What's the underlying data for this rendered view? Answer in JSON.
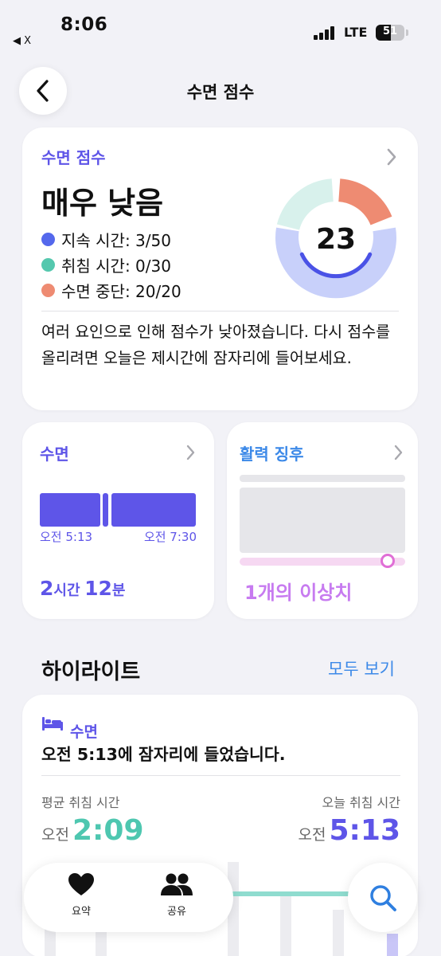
{
  "status_bar": {
    "time": "8:06",
    "back_app": "◀ X",
    "network": "LTE",
    "battery": "51"
  },
  "nav": {
    "title": "수면 점수"
  },
  "score_card": {
    "label": "수면 점수",
    "level": "매우 낮음",
    "score": "23",
    "factors": [
      {
        "label": "지속 시간: 3/50",
        "color": "#5468ec",
        "value": 3,
        "max": 50
      },
      {
        "label": "취침 시간: 0/30",
        "color": "#55c8ae",
        "value": 0,
        "max": 30
      },
      {
        "label": "수면 중단: 20/20",
        "color": "#ee8b72",
        "value": 20,
        "max": 20
      }
    ],
    "description": "여러 요인으로 인해 점수가 낮아졌습니다. 다시 점수를 올리려면 오늘은 제시간에 잠자리에 들어보세요."
  },
  "sleep_card": {
    "title": "수면",
    "start": "오전 5:13",
    "end": "오전 7:30",
    "duration_hours": "2",
    "hours_unit": "시간",
    "duration_minutes": "12",
    "minutes_unit": "분"
  },
  "vitals_card": {
    "title": "활력 징후",
    "outlier_text": "1개의 이상치"
  },
  "highlights": {
    "title": "하이라이트",
    "see_all": "모두 보기",
    "card": {
      "category": "수면",
      "sentence": "오전 5:13에 잠자리에 들었습니다.",
      "avg_label": "평균 취침 시간",
      "avg_ampm": "오전",
      "avg_time": "2:09",
      "today_label": "오늘 취침 시간",
      "today_ampm": "오전",
      "today_time": "5:13"
    }
  },
  "tabbar": {
    "summary": "요약",
    "sharing": "공유"
  },
  "colors": {
    "accent": "#5e55e8",
    "teal": "#4ec7b0",
    "coral": "#ee8b72",
    "link": "#3c89e8"
  }
}
